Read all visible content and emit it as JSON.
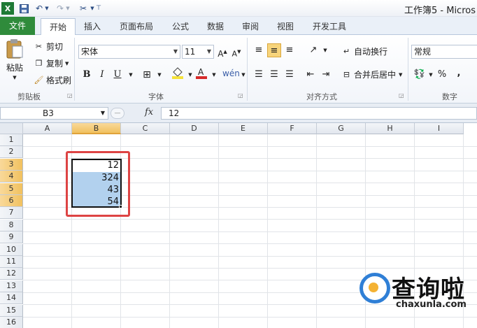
{
  "window": {
    "title": "工作簿5 - Micros"
  },
  "quick_access": {
    "undo_icon": "undo-icon",
    "redo_icon": "redo-icon"
  },
  "tabs": [
    {
      "label": "文件"
    },
    {
      "label": "开始"
    },
    {
      "label": "插入"
    },
    {
      "label": "页面布局"
    },
    {
      "label": "公式"
    },
    {
      "label": "数据"
    },
    {
      "label": "审阅"
    },
    {
      "label": "视图"
    },
    {
      "label": "开发工具"
    }
  ],
  "ribbon": {
    "clipboard": {
      "paste": "粘贴",
      "cut": "剪切",
      "copy": "复制",
      "format_painter": "格式刷",
      "group": "剪贴板"
    },
    "font": {
      "name": "宋体",
      "size": "11",
      "bold": "B",
      "italic": "I",
      "underline": "U",
      "group": "字体"
    },
    "alignment": {
      "wrap_text": "自动换行",
      "merge_center": "合并后居中",
      "group": "对齐方式"
    },
    "number": {
      "format": "常规",
      "percent": "%",
      "comma": ",",
      "group": "数字"
    }
  },
  "formula_bar": {
    "name_box": "B3",
    "fx": "fx",
    "content": "12"
  },
  "sheet": {
    "columns": [
      "A",
      "B",
      "C",
      "D",
      "E",
      "F",
      "G",
      "H",
      "I"
    ],
    "rows": [
      "1",
      "2",
      "3",
      "4",
      "5",
      "6",
      "7",
      "8",
      "9",
      "10",
      "11",
      "12",
      "13",
      "14",
      "15",
      "16"
    ],
    "cells": [
      {
        "ref": "B3",
        "value": "12"
      },
      {
        "ref": "B4",
        "value": "324"
      },
      {
        "ref": "B5",
        "value": "43"
      },
      {
        "ref": "B6",
        "value": "54"
      }
    ],
    "selected_column": "B",
    "selected_rows": [
      "3",
      "4",
      "5",
      "6"
    ]
  },
  "colors": {
    "file_tab": "#2f8b3b",
    "selection_fill": "#b2d1ee",
    "highlight_box": "#d44444",
    "header_selected": "#f1c15f"
  },
  "watermark": {
    "title": "查询啦",
    "url": "chaxunla.com"
  }
}
